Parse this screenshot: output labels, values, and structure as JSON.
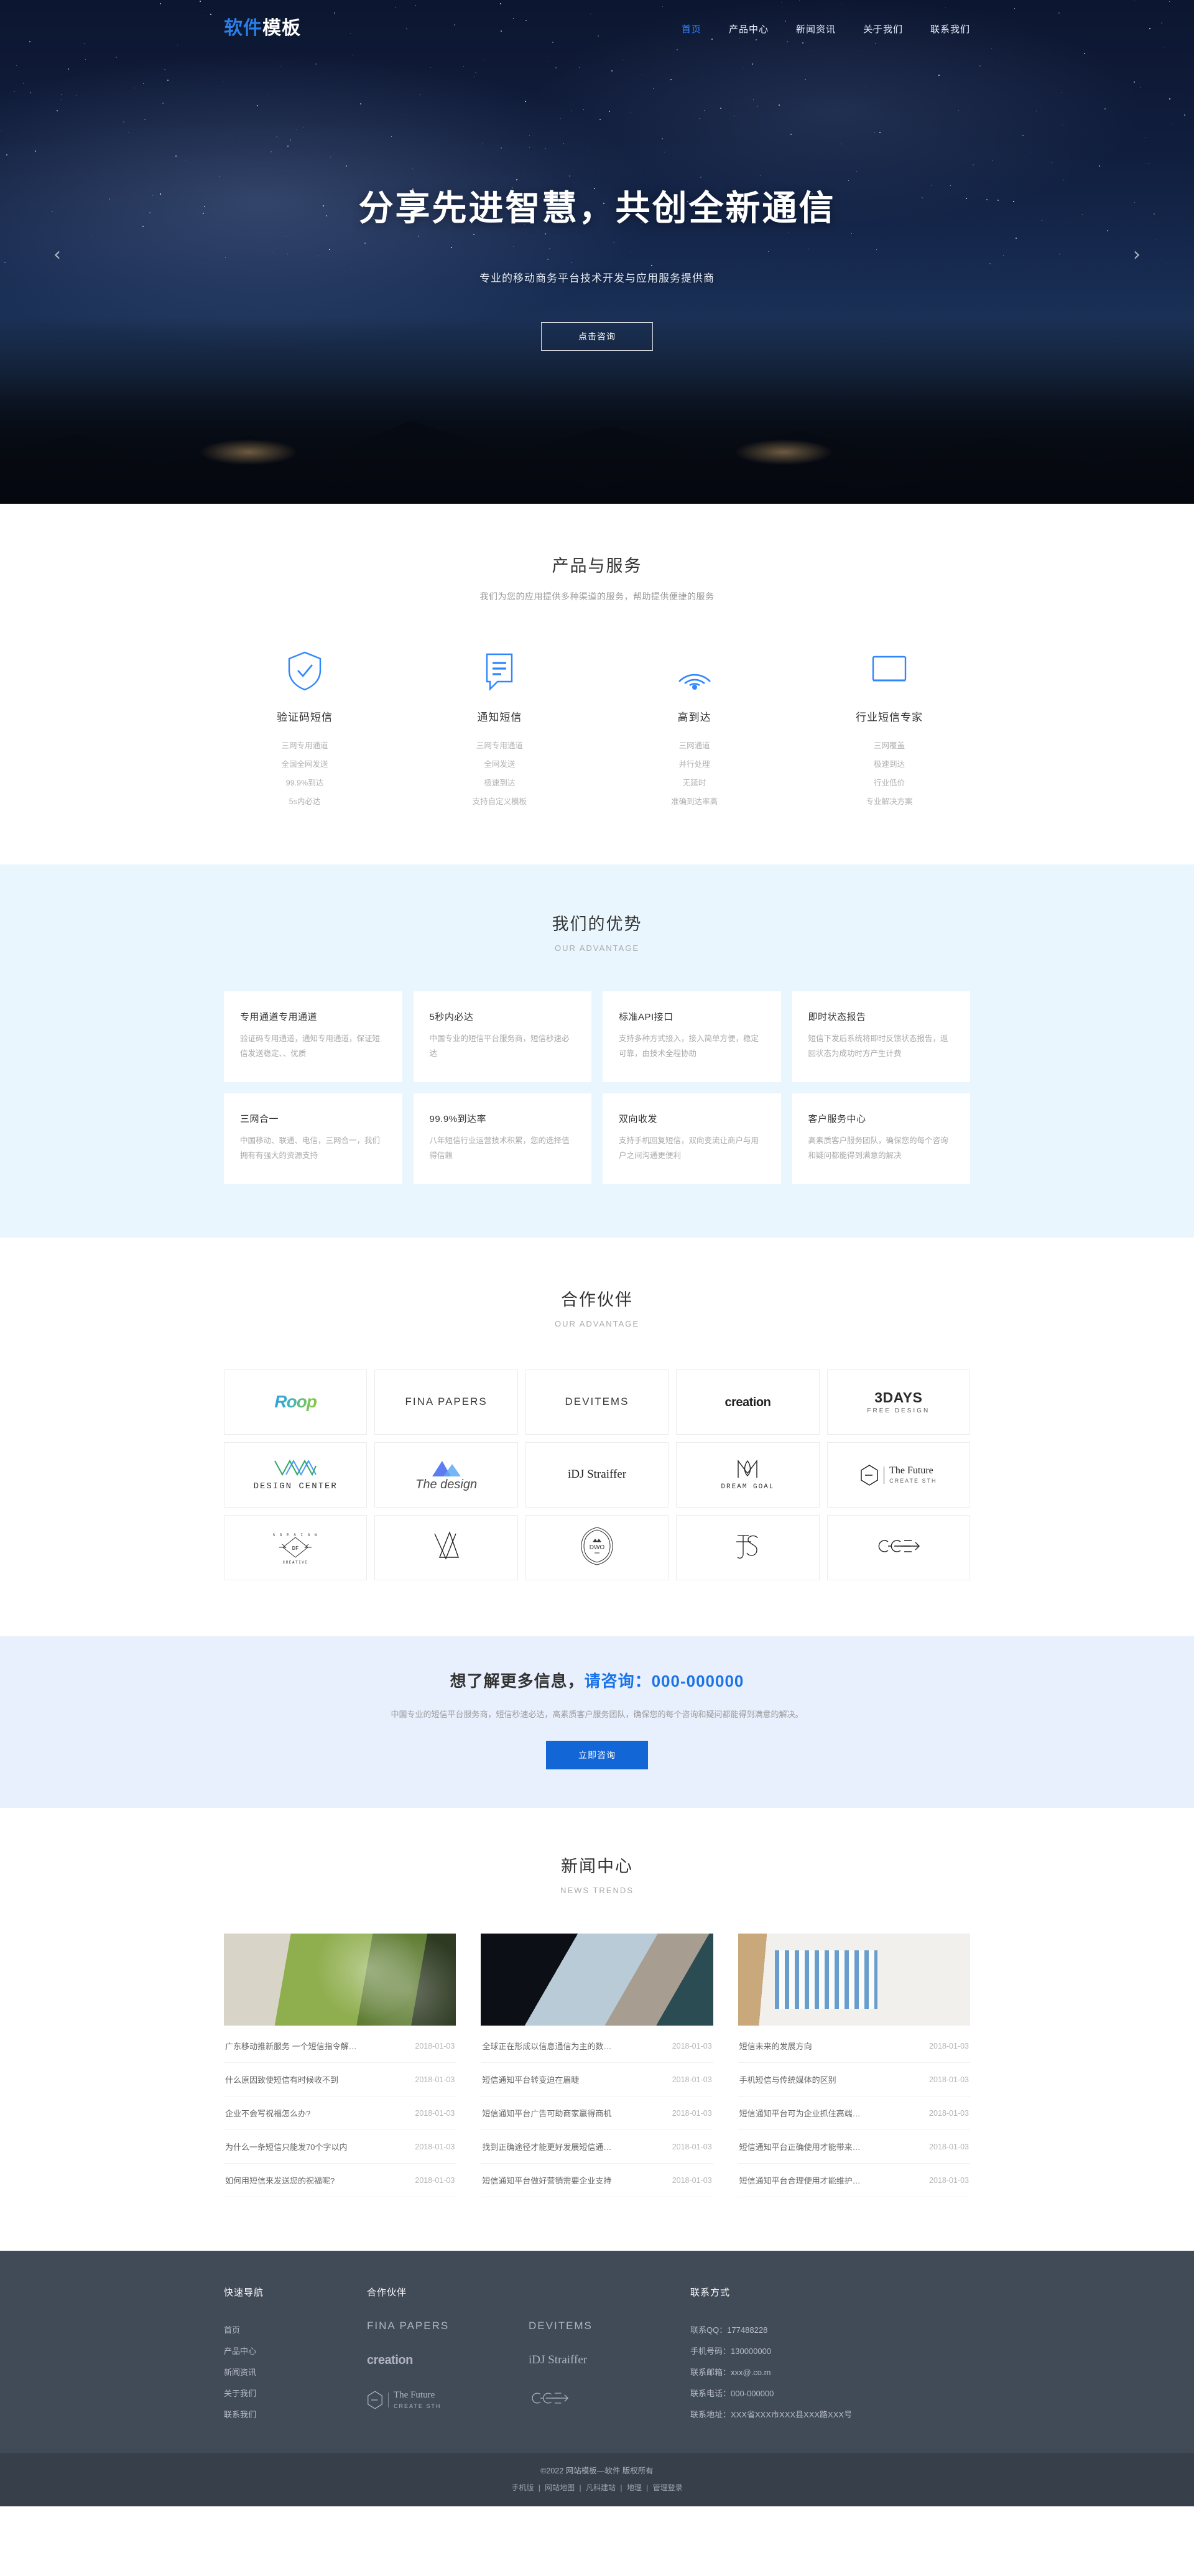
{
  "header": {
    "logo_blue": "软件",
    "logo_white": "模板",
    "nav": [
      {
        "label": "首页",
        "active": true
      },
      {
        "label": "产品中心",
        "active": false
      },
      {
        "label": "新闻资讯",
        "active": false
      },
      {
        "label": "关于我们",
        "active": false
      },
      {
        "label": "联系我们",
        "active": false
      }
    ]
  },
  "hero": {
    "title": "分享先进智慧，共创全新通信",
    "subtitle": "专业的移动商务平台技术开发与应用服务提供商",
    "button": "点击咨询",
    "prev_icon": "‹",
    "next_icon": "›"
  },
  "products": {
    "title": "产品与服务",
    "desc": "我们为您的应用提供多种渠道的服务，帮助提供便捷的服务",
    "items": [
      {
        "icon": "shield-check-icon",
        "name": "验证码短信",
        "features": [
          "三网专用通道",
          "全国全网发送",
          "99.9%到达",
          "5s内必达"
        ]
      },
      {
        "icon": "message-lines-icon",
        "name": "通知短信",
        "features": [
          "三网专用通道",
          "全网发送",
          "极速到达",
          "支持自定义模板"
        ]
      },
      {
        "icon": "wifi-signal-icon",
        "name": "高到达",
        "features": [
          "三网通道",
          "并行处理",
          "无延时",
          "准确到达率高"
        ]
      },
      {
        "icon": "monitor-screen-icon",
        "name": "行业短信专家",
        "features": [
          "三网覆盖",
          "极速到达",
          "行业低价",
          "专业解决方案"
        ]
      }
    ]
  },
  "advantage": {
    "title": "我们的优势",
    "subtitle": "OUR ADVANTAGE",
    "cards": [
      {
        "title": "专用通道专用通道",
        "text": "验证码专用通道，通知专用通道，保证短信发送稳定、、优质"
      },
      {
        "title": "5秒内必达",
        "text": "中国专业的短信平台服务商，短信秒速必达"
      },
      {
        "title": "标准API接口",
        "text": "支持多种方式接入，接入简单方便，稳定可靠，由技术全程协助"
      },
      {
        "title": "即时状态报告",
        "text": "短信下发后系统将即时反馈状态报告，返回状态为成功时方产生计费"
      },
      {
        "title": "三网合一",
        "text": "中国移动、联通、电信，三网合一，我们拥有有强大的资源支持"
      },
      {
        "title": "99.9%到达率",
        "text": "八年短信行业运营技术积累，您的选择值得信赖"
      },
      {
        "title": "双向收发",
        "text": "支持手机回复短信，双向变流让商户与用户之间沟通更便利"
      },
      {
        "title": "客户服务中心",
        "text": "高素质客户服务团队，确保您的每个咨询和疑问都能得到满意的解决"
      }
    ]
  },
  "partners": {
    "title": "合作伙伴",
    "subtitle": "OUR ADVANTAGE",
    "logos": [
      {
        "name": "Roop",
        "sub": "",
        "style": "roop"
      },
      {
        "name": "FINA PAPERS",
        "sub": "",
        "style": "thin"
      },
      {
        "name": "DEVITEMS",
        "sub": "",
        "style": "thin"
      },
      {
        "name": "creation",
        "sub": "",
        "style": "bold"
      },
      {
        "name": "3DAYS",
        "sub": "FREE DESIGN",
        "style": "days"
      },
      {
        "name": "DESIGN CENTER",
        "sub": "",
        "style": "center"
      },
      {
        "name": "The design",
        "sub": "",
        "style": "script"
      },
      {
        "name": "iDJ Straiffer",
        "sub": "",
        "style": "serif"
      },
      {
        "name": "DREAM GOAL",
        "sub": "",
        "style": "dream"
      },
      {
        "name": "The Future",
        "sub": "CREATE STH",
        "style": "future"
      },
      {
        "name": "S DESIGN OF",
        "sub": "CREATIVE",
        "style": "diamond"
      },
      {
        "name": "VA",
        "sub": "",
        "style": "va"
      },
      {
        "name": "DWO",
        "sub": "",
        "style": "dwo"
      },
      {
        "name": "JS",
        "sub": "",
        "style": "js"
      },
      {
        "name": "GGE",
        "sub": "",
        "style": "gge"
      }
    ]
  },
  "cta": {
    "title_pre": "想了解更多信息，",
    "title_hl": "请咨询：000-000000",
    "desc": "中国专业的短信平台服务商，短信秒速必达，高素质客户服务团队，确保您的每个咨询和疑问都能得到满意的解决。",
    "button": "立即咨询"
  },
  "news": {
    "title": "新闻中心",
    "subtitle": "NEWS TRENDS",
    "columns": [
      {
        "thumb": "newspaper-green-photo",
        "items": [
          {
            "title": "广东移动推新服务 一个短信指令解…",
            "date": "2018-01-03"
          },
          {
            "title": "什么原因致使短信有时候收不到",
            "date": "2018-01-03"
          },
          {
            "title": "企业不会写祝福怎么办?",
            "date": "2018-01-03"
          },
          {
            "title": "为什么一条短信只能发70个字以内",
            "date": "2018-01-03"
          },
          {
            "title": "如何用短信来发送您的祝福呢?",
            "date": "2018-01-03"
          }
        ]
      },
      {
        "thumb": "desk-notebook-photo",
        "items": [
          {
            "title": "全球正在形成以信息通信为主的数…",
            "date": "2018-01-03"
          },
          {
            "title": "短信通知平台转变迫在眉睫",
            "date": "2018-01-03"
          },
          {
            "title": "短信通知平台广告可助商家赢得商机",
            "date": "2018-01-03"
          },
          {
            "title": "找到正确途径才能更好发展短信通…",
            "date": "2018-01-03"
          },
          {
            "title": "短信通知平台做好营销需要企业支持",
            "date": "2018-01-03"
          }
        ]
      },
      {
        "thumb": "charts-documents-photo",
        "items": [
          {
            "title": "短信未来的发展方向",
            "date": "2018-01-03"
          },
          {
            "title": "手机短信与传统媒体的区别",
            "date": "2018-01-03"
          },
          {
            "title": "短信通知平台可为企业抓住高端…",
            "date": "2018-01-03"
          },
          {
            "title": "短信通知平台正确使用才能带来…",
            "date": "2018-01-03"
          },
          {
            "title": "短信通知平台合理使用才能维护…",
            "date": "2018-01-03"
          }
        ]
      }
    ]
  },
  "footer": {
    "nav_heading": "快速导航",
    "nav_links": [
      "首页",
      "产品中心",
      "新闻资讯",
      "关于我们",
      "联系我们"
    ],
    "partner_heading": "合作伙伴",
    "partner_logos": [
      {
        "name": "FINA PAPERS",
        "sub": "",
        "style": "thin"
      },
      {
        "name": "DEVITEMS",
        "sub": "",
        "style": "thin"
      },
      {
        "name": "creation",
        "sub": "",
        "style": "bold"
      },
      {
        "name": "iDJ Straiffer",
        "sub": "",
        "style": "serif"
      },
      {
        "name": "The Future",
        "sub": "CREATE STH",
        "style": "future"
      },
      {
        "name": "GGE",
        "sub": "",
        "style": "gge"
      }
    ],
    "contact_heading": "联系方式",
    "contacts": [
      "联系QQ：177488228",
      "手机号码：130000000",
      "联系邮箱：xxx@.co.m",
      "联系电话：000-000000",
      "联系地址：XXX省XXX市XXX县XXX路XXX号"
    ]
  },
  "copyright": {
    "line1": "©2022 网站模板—软件 版权所有",
    "links": [
      "手机版",
      "网站地图",
      "凡科建站",
      "地理",
      "管理登录"
    ],
    "separator": "|"
  },
  "colors": {
    "accent": "#1266d6",
    "nav_active": "#2f86ff",
    "advantage_bg": "#e9f6fd",
    "cta_bg": "#e9f0fd",
    "footer_bg": "#414a57",
    "copyright_bg": "#373f4a"
  }
}
